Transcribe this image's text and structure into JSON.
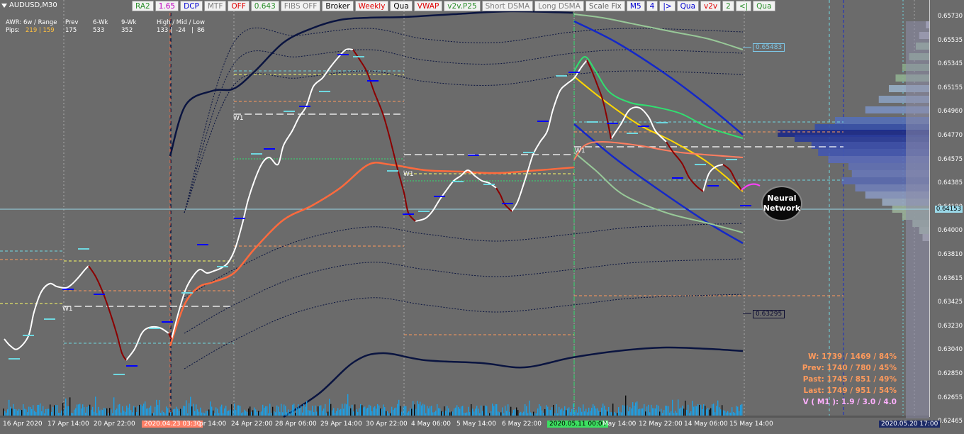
{
  "symbol": {
    "name": "AUDUSD,M30"
  },
  "toolbar": [
    {
      "label": "RA2",
      "color": "#2a8f2a"
    },
    {
      "label": "1.65",
      "color": "#c000c0"
    },
    {
      "label": "DCP",
      "color": "#0000d0"
    },
    {
      "label": "MTF",
      "color": "#808080"
    },
    {
      "label": "OFF",
      "color": "#e00000"
    },
    {
      "label": "0.643",
      "color": "#2a8f2a"
    },
    {
      "label": "FIBS OFF",
      "color": "#808080"
    },
    {
      "label": "Broker",
      "color": "#000000"
    },
    {
      "label": "Weekly",
      "color": "#e00000"
    },
    {
      "label": "Qua",
      "color": "#000000"
    },
    {
      "label": "VWAP",
      "color": "#e00000"
    },
    {
      "label": "v2v.P25",
      "color": "#2a8f2a"
    },
    {
      "label": "Short DSMA",
      "color": "#808080"
    },
    {
      "label": "Long DSMA",
      "color": "#808080"
    },
    {
      "label": "Scale Fix",
      "color": "#606060"
    },
    {
      "label": "M5",
      "color": "#0000d0"
    },
    {
      "label": "4",
      "color": "#0000d0"
    },
    {
      "label": "|>",
      "color": "#0000d0"
    },
    {
      "label": "Qua",
      "color": "#0000d0"
    },
    {
      "label": "v2v",
      "color": "#e00000"
    },
    {
      "label": "2",
      "color": "#2a8f2a"
    },
    {
      "label": "<|",
      "color": "#2a8f2a"
    },
    {
      "label": "Qua",
      "color": "#2a8f2a"
    }
  ],
  "awr": {
    "row1": {
      "label": "AWR: 6w / Range",
      "prev": "Prev",
      "sixwk": "6-Wk",
      "ninewk": "9-Wk",
      "hml": "High / Mid / Low"
    },
    "row2": {
      "label": "Pips:",
      "range": "219 | 159",
      "prev": "175",
      "sixwk": "533",
      "ninewk": "352",
      "high": "133",
      "mid": "-24",
      "low": "86"
    }
  },
  "price_axis": {
    "labels": [
      "0.65730",
      "0.65535",
      "0.65345",
      "0.65155",
      "0.64960",
      "0.64770",
      "0.64575",
      "0.64385",
      "0.64190",
      "0.64000",
      "0.63810",
      "0.63615",
      "0.63425",
      "0.63230",
      "0.63040",
      "0.62850",
      "0.62655",
      "0.62465"
    ],
    "current_price": "0.64153",
    "level_high": "0.65483",
    "level_low": "0.63295"
  },
  "time_axis": {
    "labels": [
      "16 Apr 2020",
      "17 Apr 14:00",
      "20 Apr 22:00",
      "2020.04.23 03:30",
      "pr 14:00",
      "24 Apr 22:00",
      "28 Apr 06:00",
      "29 Apr 14:00",
      "30 Apr 22:00",
      "4 May 06:00",
      "5 May 14:00",
      "6 May 22:00",
      "2020.05.11 00:00",
      "May 14:00",
      "12 May 22:00",
      "14 May 06:00",
      "15 May 14:00",
      "2020.05.20 17:00"
    ],
    "highlight_red": "2020.04.23 03:30",
    "highlight_green": "2020.05.11 00:00",
    "highlight_dark": "2020.05.20 17:00"
  },
  "week_labels": [
    "W1",
    "W1",
    "W1",
    "W1"
  ],
  "badge": {
    "line1": "Neural",
    "line2": "Network"
  },
  "stats": {
    "w": "W: 1739 / 1469 / 84%",
    "prev": "Prev: 1740 / 780 / 45%",
    "past": "Past: 1745 / 851 / 49%",
    "last": "Last: 1749 / 951 / 54%",
    "vm1": "V ( M1 ): 1.9 / 3.0 / 4.0"
  },
  "colors": {
    "background": "#6b6b6b",
    "price_line": "#ffffff",
    "down_line": "#8b0000",
    "vwap": "#ff6a3d",
    "outer_band": "#0a1440",
    "regression": "#1428c8",
    "fast_band": "#30e070",
    "volume": "#1ca0e6",
    "current_price": "#9ad8e8",
    "stats_orange": "#ff9a5c",
    "stats_pink": "#ffb0ff"
  }
}
